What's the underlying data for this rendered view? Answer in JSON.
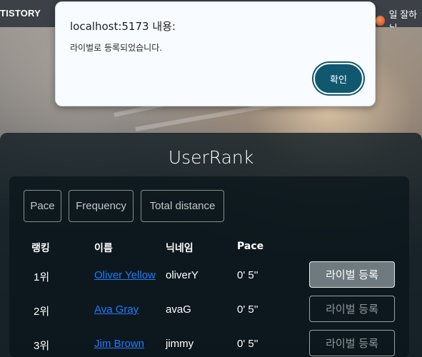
{
  "browser": {
    "bookmark_left": "TISTORY",
    "bookmark_right": "일 잘하뉘"
  },
  "dialog": {
    "title": "localhost:5173 내용:",
    "message": "라이벌로 등록되었습니다.",
    "ok_label": "확인"
  },
  "page": {
    "title": "UserRank"
  },
  "filters": [
    "Pace",
    "Frequency",
    "Total distance"
  ],
  "table": {
    "headers": [
      "랭킹",
      "이름",
      "닉네임",
      "Pace"
    ],
    "rows": [
      {
        "rank": "1위",
        "name": "Oliver Yellow",
        "nickname": "oliverY",
        "pace": "0' 5''",
        "button": "라이벌 등록"
      },
      {
        "rank": "2위",
        "name": "Ava Gray",
        "nickname": "avaG",
        "pace": "0' 5''",
        "button": "라이벌 등록"
      },
      {
        "rank": "3위",
        "name": "Jim Brown",
        "nickname": "jimmy",
        "pace": "0' 5''",
        "button": "라이벌 등록"
      }
    ]
  }
}
